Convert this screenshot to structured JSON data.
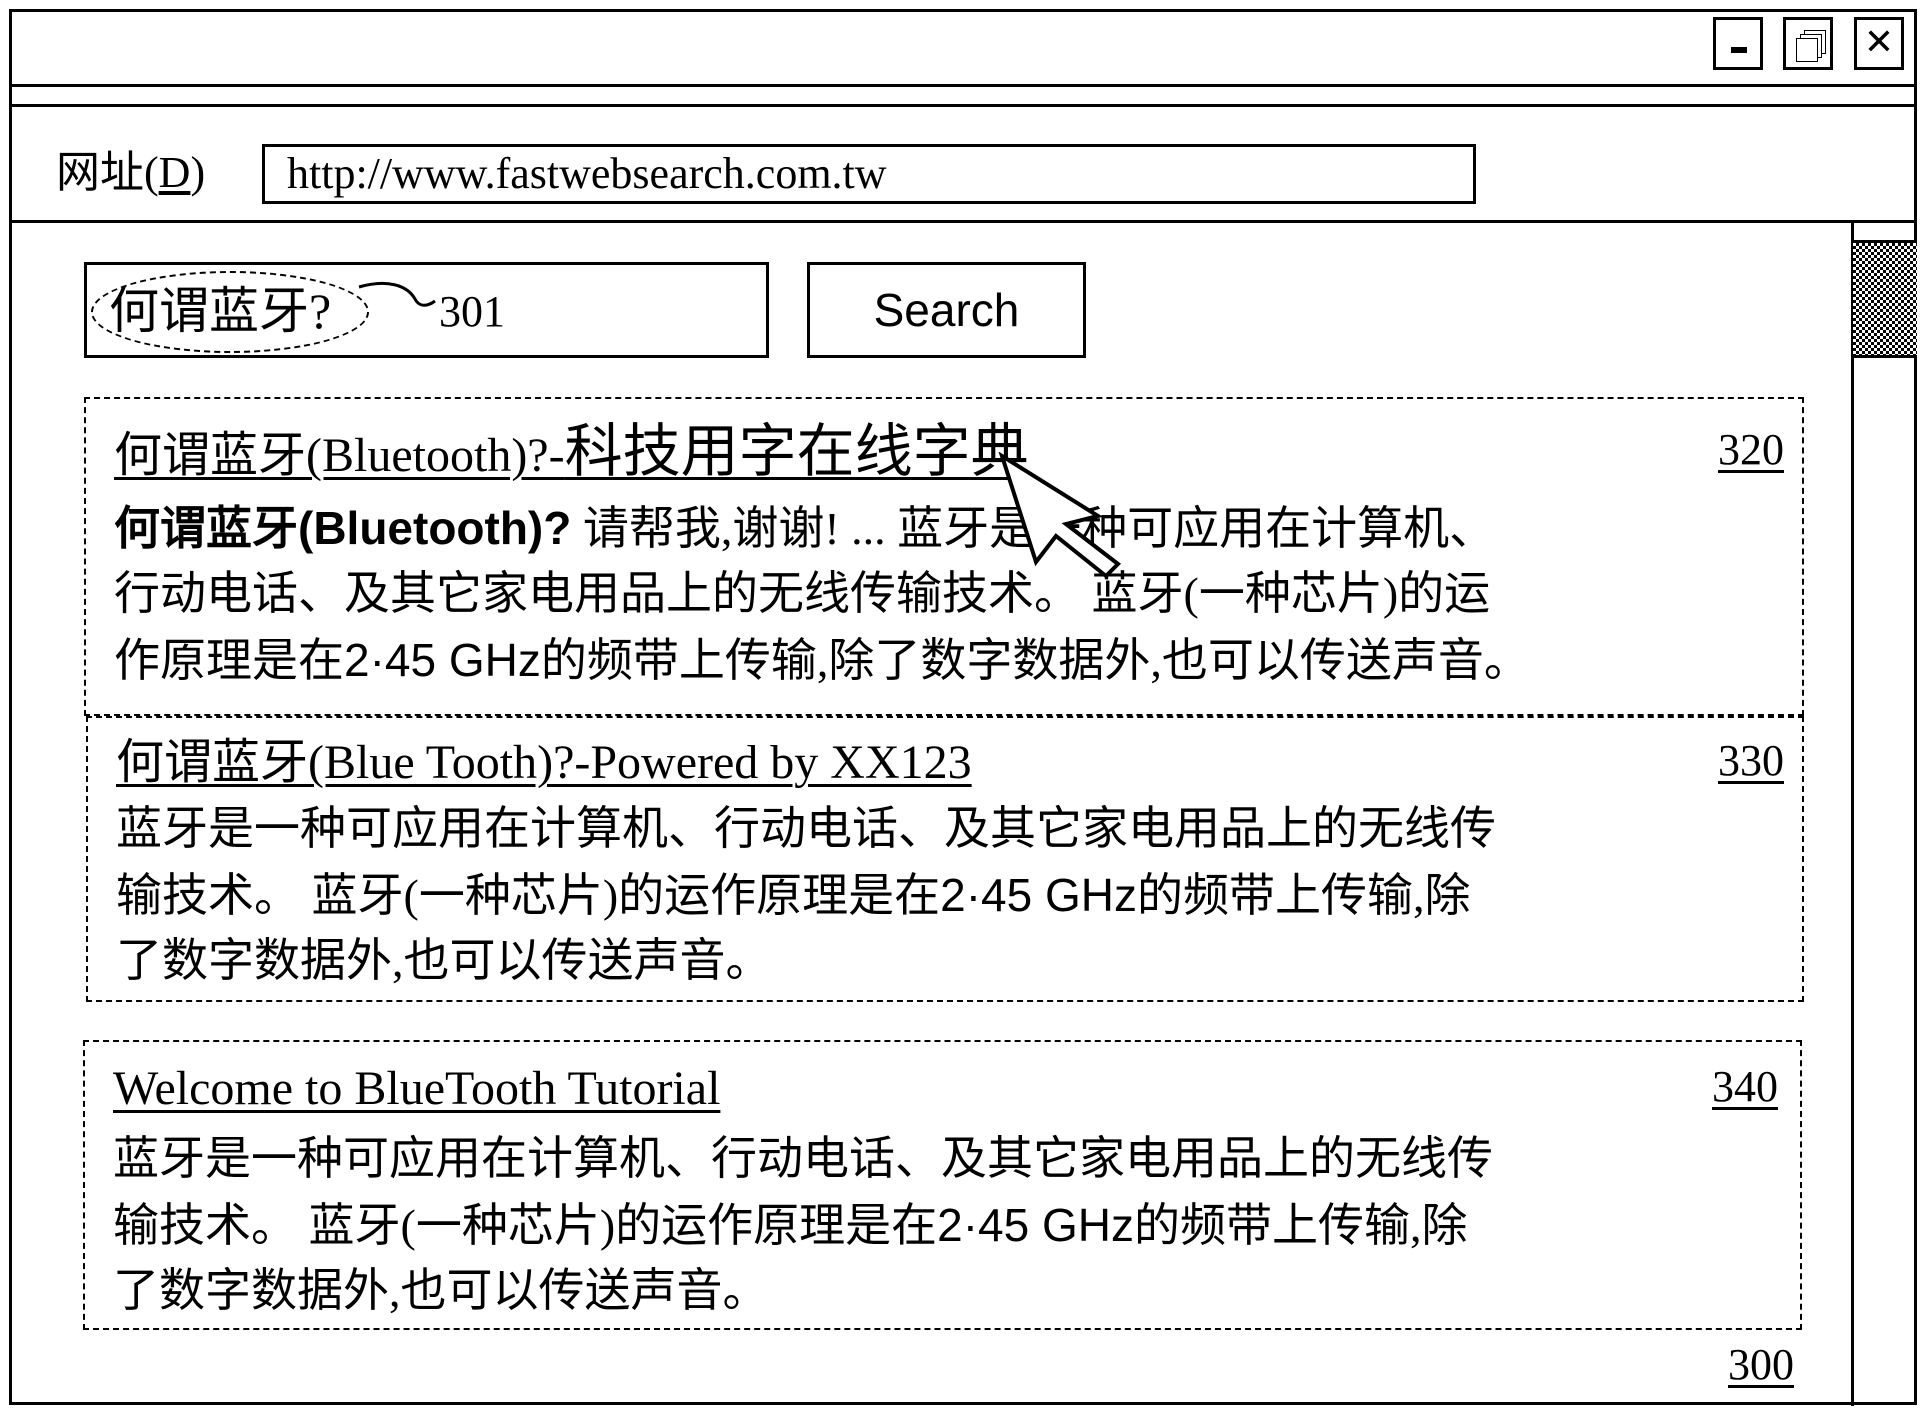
{
  "window": {
    "controls": {
      "minimize_icon": "minimize-icon",
      "restore_icon": "restore-icon",
      "close_glyph": "✕"
    }
  },
  "address_bar": {
    "label_prefix": "网址(",
    "label_accel": "D",
    "label_suffix": ")",
    "url": "http://www.fastwebsearch.com.tw"
  },
  "search": {
    "query": "何谓蓝牙?",
    "query_ref": "301",
    "button_label": "Search"
  },
  "results": [
    {
      "ref": "320",
      "title_part1": "何谓蓝牙(Bluetooth)?-",
      "title_part2": "科技用字在线字典",
      "lines": [
        {
          "bold": "何谓蓝牙(Bluetooth)?",
          "text": " 请帮我,谢谢! ... 蓝牙是一种可应用在计算机、"
        },
        {
          "text": "行动电话、及其它家电用品上的无线传输技术。 蓝牙(一种芯片)的运"
        },
        {
          "pre": "作原理是在",
          "freq": "2·45 GHz",
          "text": "的频带上传输,除了数字数据外,也可以传送声音。"
        }
      ]
    },
    {
      "ref": "330",
      "title": "何谓蓝牙(Blue Tooth)?-Powered by XX123",
      "lines": [
        {
          "text": "蓝牙是一种可应用在计算机、行动电话、及其它家电用品上的无线传"
        },
        {
          "pre": "输技术。 蓝牙(一种芯片)的运作原理是在",
          "freq": "2·45 GHz",
          "text": "的频带上传输,除"
        },
        {
          "text": "了数字数据外,也可以传送声音。"
        }
      ]
    },
    {
      "ref": "340",
      "title": "Welcome to BlueTooth Tutorial",
      "lines": [
        {
          "text": "蓝牙是一种可应用在计算机、行动电话、及其它家电用品上的无线传"
        },
        {
          "pre": "输技术。 蓝牙(一种芯片)的运作原理是在",
          "freq": "2·45 GHz",
          "text": "的频带上传输,除"
        },
        {
          "text": "了数字数据外,也可以传送声音。"
        }
      ]
    }
  ],
  "page_ref": "300",
  "cursor_icon": "mouse-pointer-icon"
}
